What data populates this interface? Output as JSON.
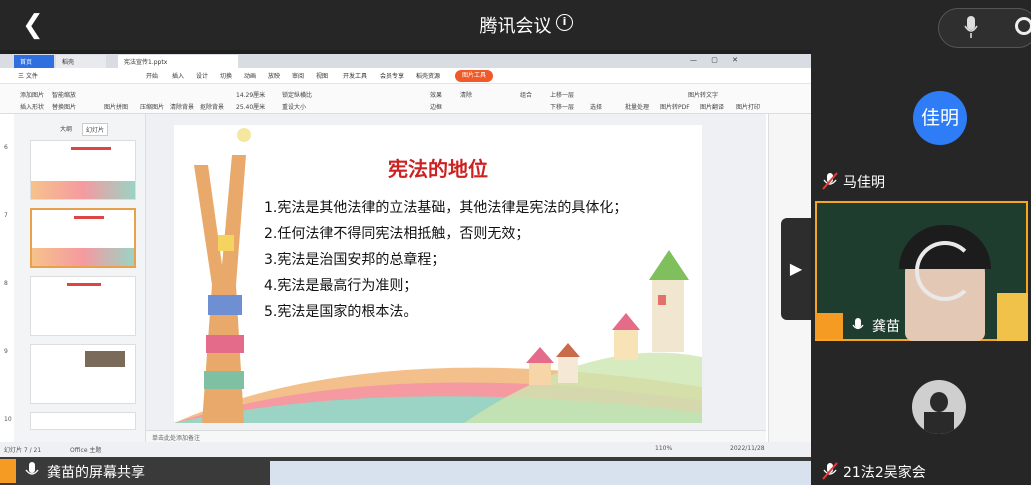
{
  "app": {
    "title": "腾讯会议"
  },
  "ppt": {
    "tabs": [
      "首页",
      "稻壳",
      "宪法宣传1.pptx"
    ],
    "menus": [
      "三 文件",
      "开始",
      "插入",
      "设计",
      "切换",
      "动画",
      "放映",
      "审阅",
      "视图",
      "开发工具",
      "会员专享",
      "稻壳资源"
    ],
    "image_tools_tab": "图片工具",
    "ribbon": {
      "group1": [
        "添加图片",
        "智能缩放",
        "插入形状",
        "替换图片",
        "图片拼图",
        "压缩图片",
        "清除背景",
        "抠除背景"
      ],
      "size_w": "14.29厘米",
      "size_h": "25.40厘米",
      "lock_ratio": "锁定纵横比",
      "reset_size": "重设大小",
      "right_labels": [
        "效果",
        "清除",
        "边框",
        "组合",
        "上移一层",
        "下移一层",
        "选择",
        "批量处理",
        "图片转文字",
        "图片转PDF",
        "图片翻译",
        "图片打印"
      ]
    },
    "outline_tabs": [
      "大纲",
      "幻灯片"
    ],
    "thumb_numbers": [
      "6",
      "7",
      "8",
      "9",
      "10"
    ],
    "notes_placeholder": "单击此处添加备注",
    "status": {
      "slide_info": "幻灯片 7 / 21",
      "theme": "Office 主题",
      "zoom": "110%",
      "date": "2022/11/28"
    }
  },
  "slide": {
    "title": "宪法的地位",
    "lines": [
      "1.宪法是其他法律的立法基础，其他法律是宪法的具体化；",
      "2.任何法律不得同宪法相抵触，否则无效；",
      "3.宪法是治国安邦的总章程；",
      "4.宪法是最高行为准则；",
      "5.宪法是国家的根本法。"
    ]
  },
  "share": {
    "text": "龚苗的屏幕共享"
  },
  "participants": [
    {
      "avatar_text": "佳明",
      "name": "马佳明",
      "color": "#2e7cf6"
    },
    {
      "name": "龚苗"
    },
    {
      "name": "21法2吴家会"
    }
  ]
}
